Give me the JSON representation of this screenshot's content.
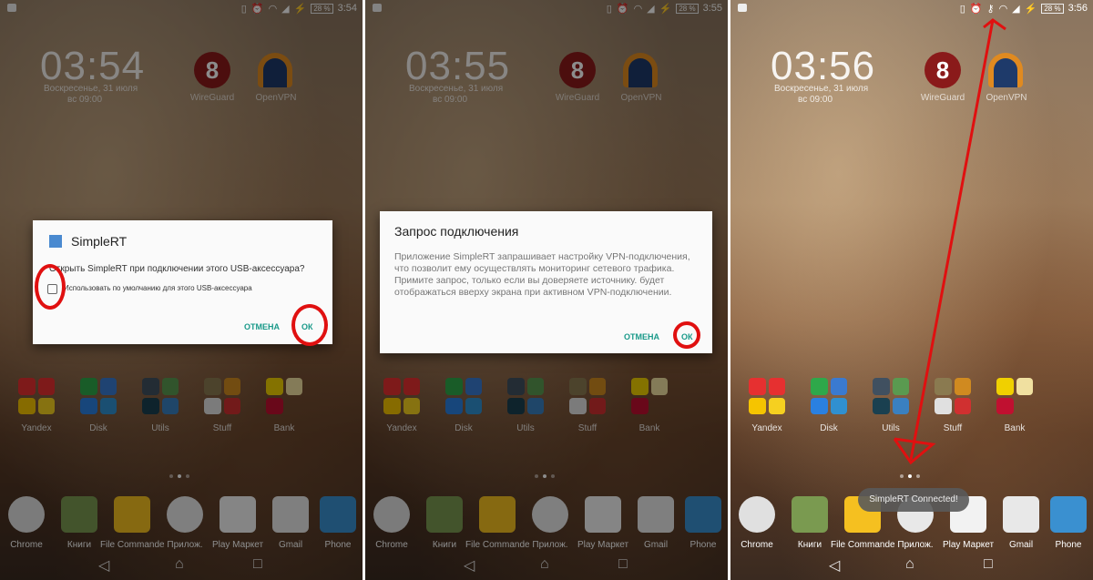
{
  "panels": [
    {
      "status_time": "3:54",
      "battery": "28 %",
      "clock": "03:54",
      "date": "Воскресенье, 31 июля",
      "alarm": "вс 09:00",
      "dimmed": true,
      "dialog": {
        "type": "usb",
        "app_name": "SimpleRT",
        "message": "Открыть SimpleRT при подключении этого USB-аксессуара?",
        "checkbox_label": "Использовать по умолчанию для этого USB-аксессуара",
        "checkbox_checked": false,
        "cancel": "ОТМЕНА",
        "ok": "ОК"
      }
    },
    {
      "status_time": "3:55",
      "battery": "28 %",
      "clock": "03:55",
      "date": "Воскресенье, 31 июля",
      "alarm": "вс 09:00",
      "dimmed": true,
      "dialog": {
        "type": "vpn",
        "title": "Запрос подключения",
        "message": "Приложение SimpleRT запрашивает настройку VPN-подключения, что позволит ему осуществлять мониторинг сетевого трафика. Примите запрос, только если вы доверяете источнику. будет отображаться вверху экрана при активном VPN-подключении.",
        "cancel": "ОТМЕНА",
        "ok": "ОК"
      }
    },
    {
      "status_time": "3:56",
      "battery": "28 %",
      "clock": "03:56",
      "date": "Воскресенье, 31 июля",
      "alarm": "вс 09:00",
      "dimmed": false,
      "vpn_key_icon": true,
      "toast": "SimpleRT Connected!"
    }
  ],
  "shortcuts": [
    {
      "label": "WireGuard",
      "icon": "wireguard-icon"
    },
    {
      "label": "OpenVPN",
      "icon": "openvpn-icon"
    }
  ],
  "folders": [
    {
      "label": "Yandex",
      "colors": [
        "#e63030",
        "#e63030",
        "#f5c400",
        "#f5d020"
      ]
    },
    {
      "label": "Disk",
      "colors": [
        "#2ea84a",
        "#3a7ad0",
        "#2a80e0",
        "#3090d0"
      ]
    },
    {
      "label": "Utils",
      "colors": [
        "#405060",
        "#5a9a50",
        "#1a4050",
        "#3a80c0"
      ]
    },
    {
      "label": "Stuff",
      "colors": [
        "#8a7a50",
        "#d08a20",
        "#e0e0e0",
        "#d03030"
      ]
    },
    {
      "label": "Bank",
      "colors": [
        "#f0d000",
        "#f0e0a0",
        "#c01030",
        "transparent"
      ]
    }
  ],
  "dock": [
    {
      "label": "Chrome",
      "icon": "chrome-icon",
      "color": "#e0e0e0"
    },
    {
      "label": "Книги",
      "icon": "books-folder-icon",
      "color": "#7a9a50"
    },
    {
      "label": "File Commander",
      "icon": "file-commander-icon",
      "color": "#f5c020"
    },
    {
      "label": "Прилож.",
      "icon": "app-drawer-icon",
      "color": "#e8e8e8"
    },
    {
      "label": "Play Маркет",
      "icon": "play-store-icon",
      "color": "#f2f2f2"
    },
    {
      "label": "Gmail",
      "icon": "gmail-icon",
      "color": "#e8e8e8"
    },
    {
      "label": "Phone",
      "icon": "phone-folder-icon",
      "color": "#3a90d0"
    }
  ],
  "annotation_color": "#e01010",
  "accent": "#1a9a8a"
}
